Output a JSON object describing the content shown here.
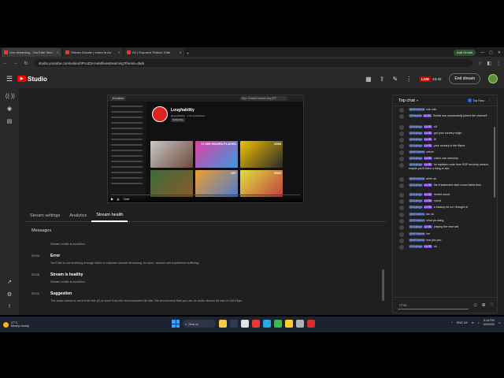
{
  "browser": {
    "tabs": [
      {
        "label": "Live streaming - YouTube Stud",
        "active": true
      },
      {
        "label": "Stream Donate | Listen to Au",
        "active": false
      },
      {
        "label": "D2 | Exposed 'Roblox' Kids",
        "active": false
      }
    ],
    "profile": "Add Gmobi",
    "url": "studio.youtube.com/video/0PcoZ2AAeM/livestreaming?theme=dark"
  },
  "studio": {
    "logo_text": "Studio",
    "live_label": "LIVE",
    "live_time": "43:40",
    "end_stream": "End stream"
  },
  "preview": {
    "channel_name": "Loughability",
    "channel_sub": "@loughability · 1.2K subscribers",
    "subscribe_label": "Subscribe",
    "search_placeholder": "Rye: Default stream key (RT",
    "tab_label": "Excellent",
    "thumb_labels": [
      "",
      "17,000 HOURS PLAYED",
      "2006",
      "",
      "#97",
      "2026"
    ],
    "controls": "Live"
  },
  "stream_tabs": [
    "Stream settings",
    "Analytics",
    "Stream health"
  ],
  "health": {
    "messages_title": "Messages",
    "top_note": "Stream health is excellent.",
    "entries": [
      {
        "time": "20:04",
        "title": "Error",
        "body": "YouTube is not receiving enough video to maintain smooth streaming. As such, viewers will experience buffering."
      },
      {
        "time": "20:25",
        "title": "Stream is healthy",
        "body": "Stream health is excellent."
      },
      {
        "time": "20:21",
        "title": "Suggestion",
        "body": "The audio stream's current bit rate (0) is lower than the recommended bit rate. We recommend that you use an audio stream bit rate of 128 Kbps."
      }
    ]
  },
  "chat": {
    "title": "Top chat",
    "top_fans": "Top Fans",
    "input_placeholder": "Chat...",
    "messages": [
      {
        "name": "@elf.thimen",
        "badge": "",
        "text": "nah nah"
      },
      {
        "name": "@Ihsanfo",
        "badge": "Lv 91",
        "text": "Bot4is has successfully joined the channel!"
      },
      {
        "name": "@Avjicigo",
        "badge": "Lv 91",
        "text": "xD"
      },
      {
        "name": "@Avjicigo",
        "badge": "Lv 91",
        "text": "got your country origin"
      },
      {
        "name": "@Avjicigo",
        "badge": "Lv 91",
        "text": "W"
      },
      {
        "name": "@Avjicigo",
        "badge": "Lv 91",
        "text": "your country is the filipos"
      },
      {
        "name": "@elf.thimen",
        "badge": "",
        "text": "nahhh"
      },
      {
        "name": "@Avjicigo",
        "badge": "Lv 91",
        "text": "check can oneshop"
      },
      {
        "name": "@Avjicigo",
        "badge": "Lv 91",
        "text": "he explains code from SGP security breach, maybe you'll learn a thing or two"
      },
      {
        "name": "@elf.thimen",
        "badge": "",
        "text": "ahhh ok"
      },
      {
        "name": "@Avjicigo",
        "badge": "Lv 91",
        "text": "the if statement start round failed then"
      },
      {
        "name": "@Avjicigo",
        "badge": "Lv 91",
        "text": "restart round"
      },
      {
        "name": "@Avjicigo",
        "badge": "Lv 91",
        "text": "round"
      },
      {
        "name": "@Avjicigo",
        "badge": "Lv 91",
        "text": "a backup for so i thought of"
      },
      {
        "name": "@elf.thimen",
        "badge": "",
        "text": "fan ok"
      },
      {
        "name": "@elf.thimen",
        "badge": "",
        "text": "what ya doing"
      },
      {
        "name": "@Avjicigo",
        "badge": "Lv 91",
        "text": "playing the new wal"
      },
      {
        "name": "@elf.thimen",
        "badge": "",
        "text": "hm"
      },
      {
        "name": "@elf.thimen",
        "badge": "",
        "text": "ima join you"
      },
      {
        "name": "@Avjicigo",
        "badge": "Lv 91",
        "text": "ok"
      }
    ]
  },
  "taskbar": {
    "weather_temp": "27°C",
    "weather_desc": "Mostly cloudy",
    "search_label": "Search",
    "lang": "ENG US",
    "time": "8:16 PM",
    "date": "9/4/2026"
  }
}
